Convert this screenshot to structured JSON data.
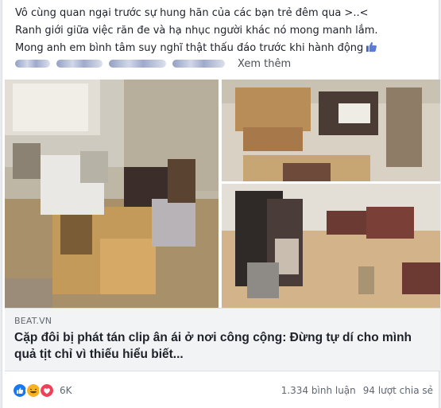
{
  "post": {
    "lines": [
      "Vô cùng quan ngại trước sự hung hãn của các bạn trẻ đêm qua >..<",
      "Ranh giới giữa việc răn đe và hạ nhục người khác nó mong manh lắm.",
      "Mong anh em bình tâm suy nghĩ thật thấu đáo trước khi hành động"
    ],
    "thumb_icon": "thumbs-up-emoji",
    "see_more": "Xem thêm"
  },
  "link_preview": {
    "source": "BEAT.VN",
    "title": "Cặp đôi bị phát tán clip ân ái ở nơi công cộng: Đừng tự dí cho mình quả tịt chỉ vì thiếu hiểu biết..."
  },
  "reactions": {
    "icons": [
      "like-reaction-icon",
      "haha-reaction-icon",
      "love-reaction-icon"
    ],
    "count": "6K",
    "comments": "1.334 bình luận",
    "shares": "94 lượt chia sẻ"
  },
  "colors": {
    "like": "#1877f2",
    "haha": "#f7b125",
    "love": "#f33e58",
    "link_bg": "#f2f3f5"
  }
}
